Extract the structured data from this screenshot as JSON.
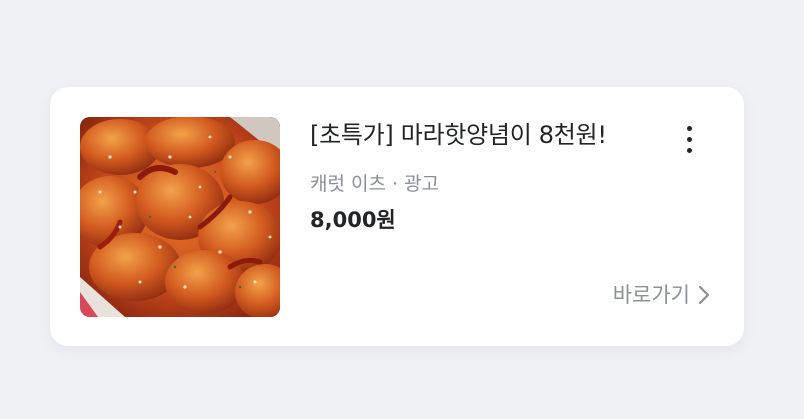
{
  "ad_card": {
    "title": "[초특가] 마라핫양념이 8천원!",
    "advertiser": "캐럿 이츠",
    "separator": "·",
    "ad_label": "광고",
    "price": "8,000원",
    "cta_label": "바로가기",
    "icons": {
      "menu": "more-vertical-icon",
      "cta": "chevron-right-icon"
    },
    "image": "spicy-fried-chicken-photo",
    "colors": {
      "page_background": "#f0f1f5",
      "card_background": "#ffffff",
      "title_text": "#222426",
      "secondary_text": "#8b8f96"
    }
  }
}
